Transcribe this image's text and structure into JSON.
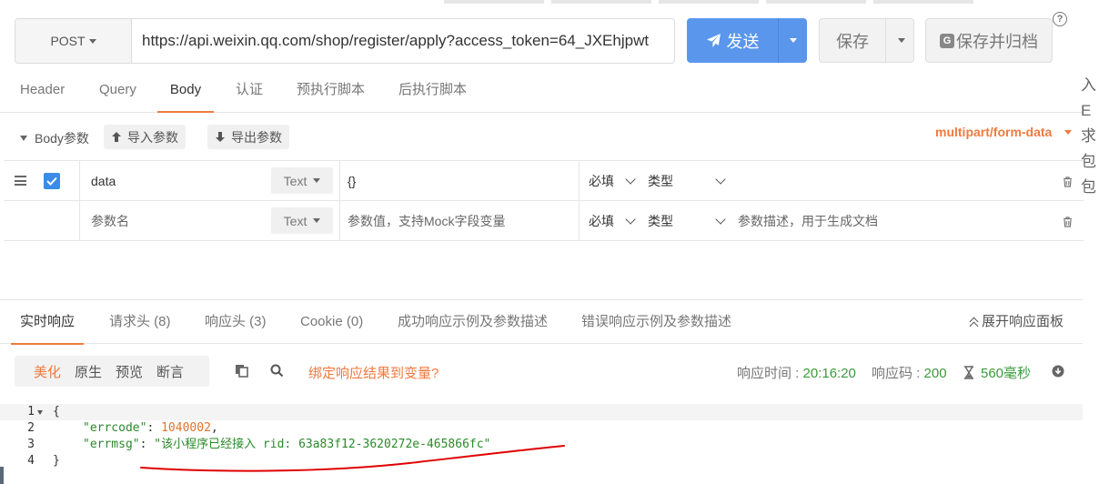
{
  "request": {
    "method": "POST",
    "url": "https://api.weixin.qq.com/shop/register/apply?access_token=64_JXEhjpwt",
    "send_label": "发送",
    "save_label": "保存",
    "save_archive_label": "保存并归档",
    "archive_icon_letter": "G",
    "help_symbol": "?"
  },
  "tabs": [
    "Header",
    "Query",
    "Body",
    "认证",
    "预执行脚本",
    "后执行脚本"
  ],
  "active_tab": "Body",
  "body_toolbar": {
    "label": "Body参数",
    "import_label": "导入参数",
    "export_label": "导出参数",
    "content_type": "multipart/form-data"
  },
  "params": [
    {
      "name": "data",
      "type": "Text",
      "value": "{}",
      "required": "必填",
      "kind": "类型",
      "desc": "",
      "checked": true
    },
    {
      "name_placeholder": "参数名",
      "type": "Text",
      "value_placeholder": "参数值，支持Mock字段变量",
      "required": "必填",
      "kind": "类型",
      "desc_placeholder": "参数描述，用于生成文档"
    }
  ],
  "response_tabs": [
    "实时响应",
    "请求头 (8)",
    "响应头 (3)",
    "Cookie (0)",
    "成功响应示例及参数描述",
    "错误响应示例及参数描述"
  ],
  "expand_label": "展开响应面板",
  "format_options": [
    "美化",
    "原生",
    "预览",
    "断言"
  ],
  "format_selected": "美化",
  "bind_var_label": "绑定响应结果到变量?",
  "response_meta": {
    "time_label": "响应时间 : ",
    "time": "20:16:20",
    "code_label": "响应码 : ",
    "code": "200",
    "duration": "560毫秒"
  },
  "response_body": {
    "line_numbers": [
      "1",
      "2",
      "3",
      "4"
    ],
    "open_brace": "{",
    "close_brace": "}",
    "errcode_key": "\"errcode\"",
    "errcode_value": "1040002",
    "errmsg_key": "\"errmsg\"",
    "errmsg_value": "\"该小程序已经接入 rid: 63a83f12-3620272e-465866fc\""
  },
  "right_edge_glyphs": [
    "入",
    "E",
    "求",
    "包",
    "包"
  ],
  "colors": {
    "primary": "#5a97ec",
    "accent": "#f07a3e",
    "success": "#3a9a3a",
    "annotation": "#e00000"
  }
}
